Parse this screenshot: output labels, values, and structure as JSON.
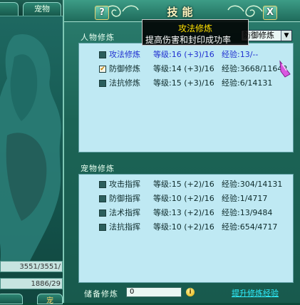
{
  "background": {
    "tabs": [
      "",
      "宠物"
    ],
    "stats": [
      "3551/3551/",
      "1886/29"
    ],
    "bottom_tabs": [
      "",
      "宠"
    ]
  },
  "window": {
    "title": "技能",
    "help_icon": "?",
    "close_icon": "X"
  },
  "tooltip": {
    "title": "攻法修炼",
    "description": "提高伤害和封印成功率"
  },
  "character_cultivation": {
    "section_label": "人物修炼",
    "dropdown_value": "防御修炼",
    "rows": [
      {
        "checked": false,
        "name": "攻法修炼",
        "level": "等级:16 (+3)/16",
        "exp": "经验:13/--",
        "highlight": true
      },
      {
        "checked": true,
        "name": "防御修炼",
        "level": "等级:14 (+3)/16",
        "exp": "经验:3668/11642",
        "highlight": false
      },
      {
        "checked": false,
        "name": "法抗修炼",
        "level": "等级:15 (+3)/16",
        "exp": "经验:6/14131",
        "highlight": false
      }
    ]
  },
  "pet_cultivation": {
    "section_label": "宠物修炼",
    "rows": [
      {
        "checked": false,
        "name": "攻击指挥",
        "level": "等级:15 (+2)/16",
        "exp": "经验:304/14131"
      },
      {
        "checked": false,
        "name": "防御指挥",
        "level": "等级:10 (+2)/16",
        "exp": "经验:1/4717"
      },
      {
        "checked": false,
        "name": "法术指挥",
        "level": "等级:13 (+2)/16",
        "exp": "经验:13/9484"
      },
      {
        "checked": false,
        "name": "法抗指挥",
        "level": "等级:10 (+2)/16",
        "exp": "经验:654/4717"
      }
    ]
  },
  "footer": {
    "reserve_label": "储备修炼",
    "reserve_value": "0",
    "info_icon": "i",
    "upgrade_link": "提升修炼经验"
  },
  "colors": {
    "window_bg": "#1c6456",
    "list_bg": "#bfe9f3",
    "highlight_text": "#1f2fd0",
    "tooltip_title": "#ffe000",
    "link": "#2ff0ff"
  }
}
